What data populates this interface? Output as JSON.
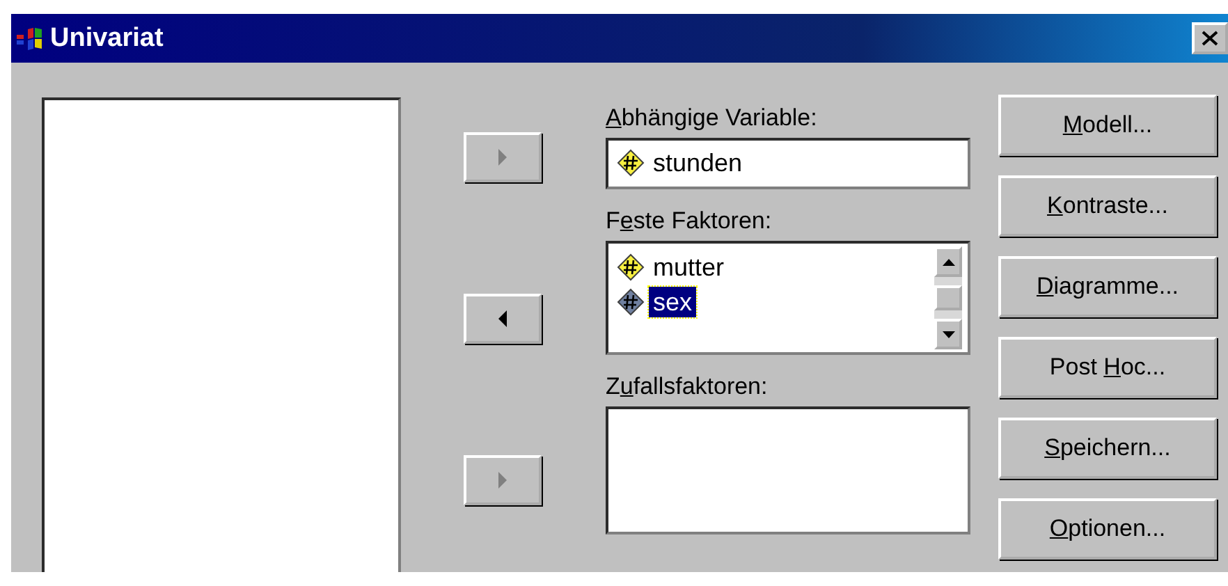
{
  "window": {
    "title": "Univariat"
  },
  "arrow_buttons": [
    {
      "kind": "right",
      "disabled": true
    },
    {
      "kind": "left",
      "disabled": false
    },
    {
      "kind": "right",
      "disabled": true
    }
  ],
  "dependent": {
    "label": {
      "key": "A",
      "after": "bhängige Variable:"
    },
    "variables": [
      {
        "name": "stunden",
        "selected": false
      }
    ]
  },
  "fixed_factors": {
    "label": {
      "before": "F",
      "key": "e",
      "after": "ste Faktoren:"
    },
    "variables": [
      {
        "name": "mutter",
        "selected": false
      },
      {
        "name": "sex",
        "selected": true
      }
    ]
  },
  "random_factors": {
    "label": {
      "before": "Z",
      "key": "u",
      "after": "fallsfaktoren:"
    }
  },
  "buttons": [
    {
      "label": {
        "key": "M",
        "after": "odell..."
      }
    },
    {
      "label": {
        "key": "K",
        "after": "ontraste..."
      }
    },
    {
      "label": {
        "key": "D",
        "after": "iagramme..."
      }
    },
    {
      "label": {
        "before": "Post ",
        "key": "H",
        "after": "oc..."
      }
    },
    {
      "label": {
        "key": "S",
        "after": "peichern..."
      }
    },
    {
      "label": {
        "key": "O",
        "after": "ptionen..."
      }
    }
  ]
}
